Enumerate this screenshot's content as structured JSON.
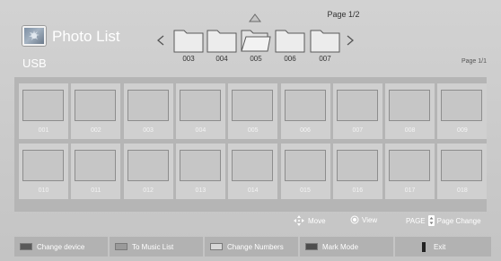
{
  "header": {
    "title": "Photo List",
    "device": "USB",
    "page_top": "Page 1/2",
    "page_small": "Page 1/1"
  },
  "folders": [
    {
      "label": "003",
      "selected": false
    },
    {
      "label": "004",
      "selected": false
    },
    {
      "label": "005",
      "selected": true
    },
    {
      "label": "006",
      "selected": false
    },
    {
      "label": "007",
      "selected": false
    }
  ],
  "thumbnails": [
    "001",
    "002",
    "003",
    "004",
    "005",
    "006",
    "007",
    "008",
    "009",
    "010",
    "011",
    "012",
    "013",
    "014",
    "015",
    "016",
    "017",
    "018"
  ],
  "hints": {
    "move": "Move",
    "view": "View",
    "page_key": "PAGE",
    "page_change": "Page Change"
  },
  "buttons": [
    {
      "label": "Change device",
      "color": "#5a5a5a"
    },
    {
      "label": "To Music List",
      "color": "#9a9a9a"
    },
    {
      "label": "Change Numbers",
      "color": "#d8d8d8"
    },
    {
      "label": "Mark Mode",
      "color": "#4e4e4e"
    },
    {
      "label": "Exit",
      "color": "#222222"
    }
  ],
  "colors": {
    "background": "#c9c9c9",
    "panel": "#b5b5b5",
    "text_light": "#ffffff"
  }
}
